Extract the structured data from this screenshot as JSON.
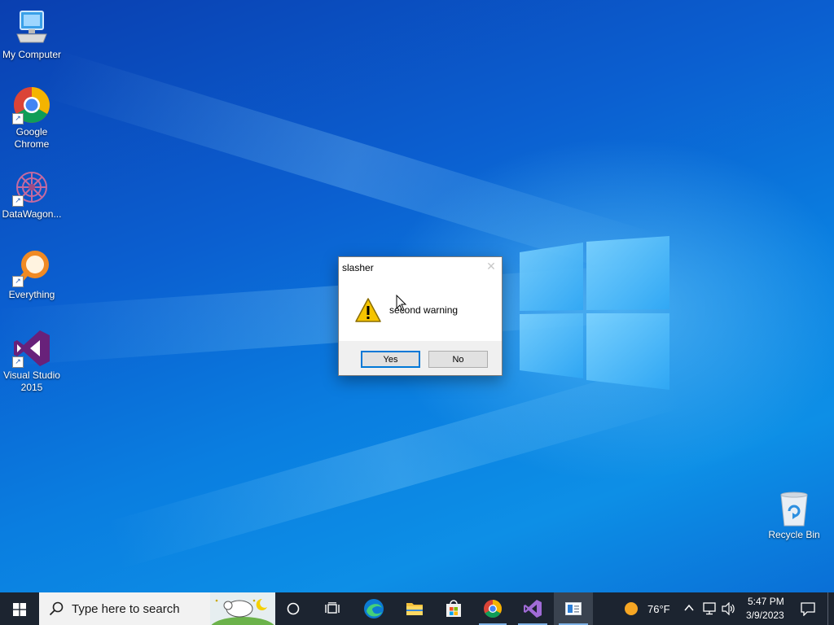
{
  "desktop": {
    "icons": [
      {
        "label": "My Computer"
      },
      {
        "label": "Google Chrome"
      },
      {
        "label": "DataWagon..."
      },
      {
        "label": "Everything"
      },
      {
        "label": "Visual Studio 2015"
      },
      {
        "label": "Recycle Bin"
      }
    ]
  },
  "dialog": {
    "title": "slasher",
    "close_glyph": "✕",
    "message": "second warning",
    "yes_label": "Yes",
    "no_label": "No",
    "icon": "warning-icon"
  },
  "taskbar": {
    "search_placeholder": "Type here to search",
    "pinned": [
      "task-view",
      "edge",
      "file-explorer",
      "microsoft-store",
      "chrome",
      "visual-studio",
      "app-window"
    ],
    "weather": {
      "temp": "76°F",
      "icon": "sun-icon"
    },
    "clock": {
      "time": "5:47 PM",
      "date": "3/9/2023"
    },
    "accent": "#0078d7"
  }
}
